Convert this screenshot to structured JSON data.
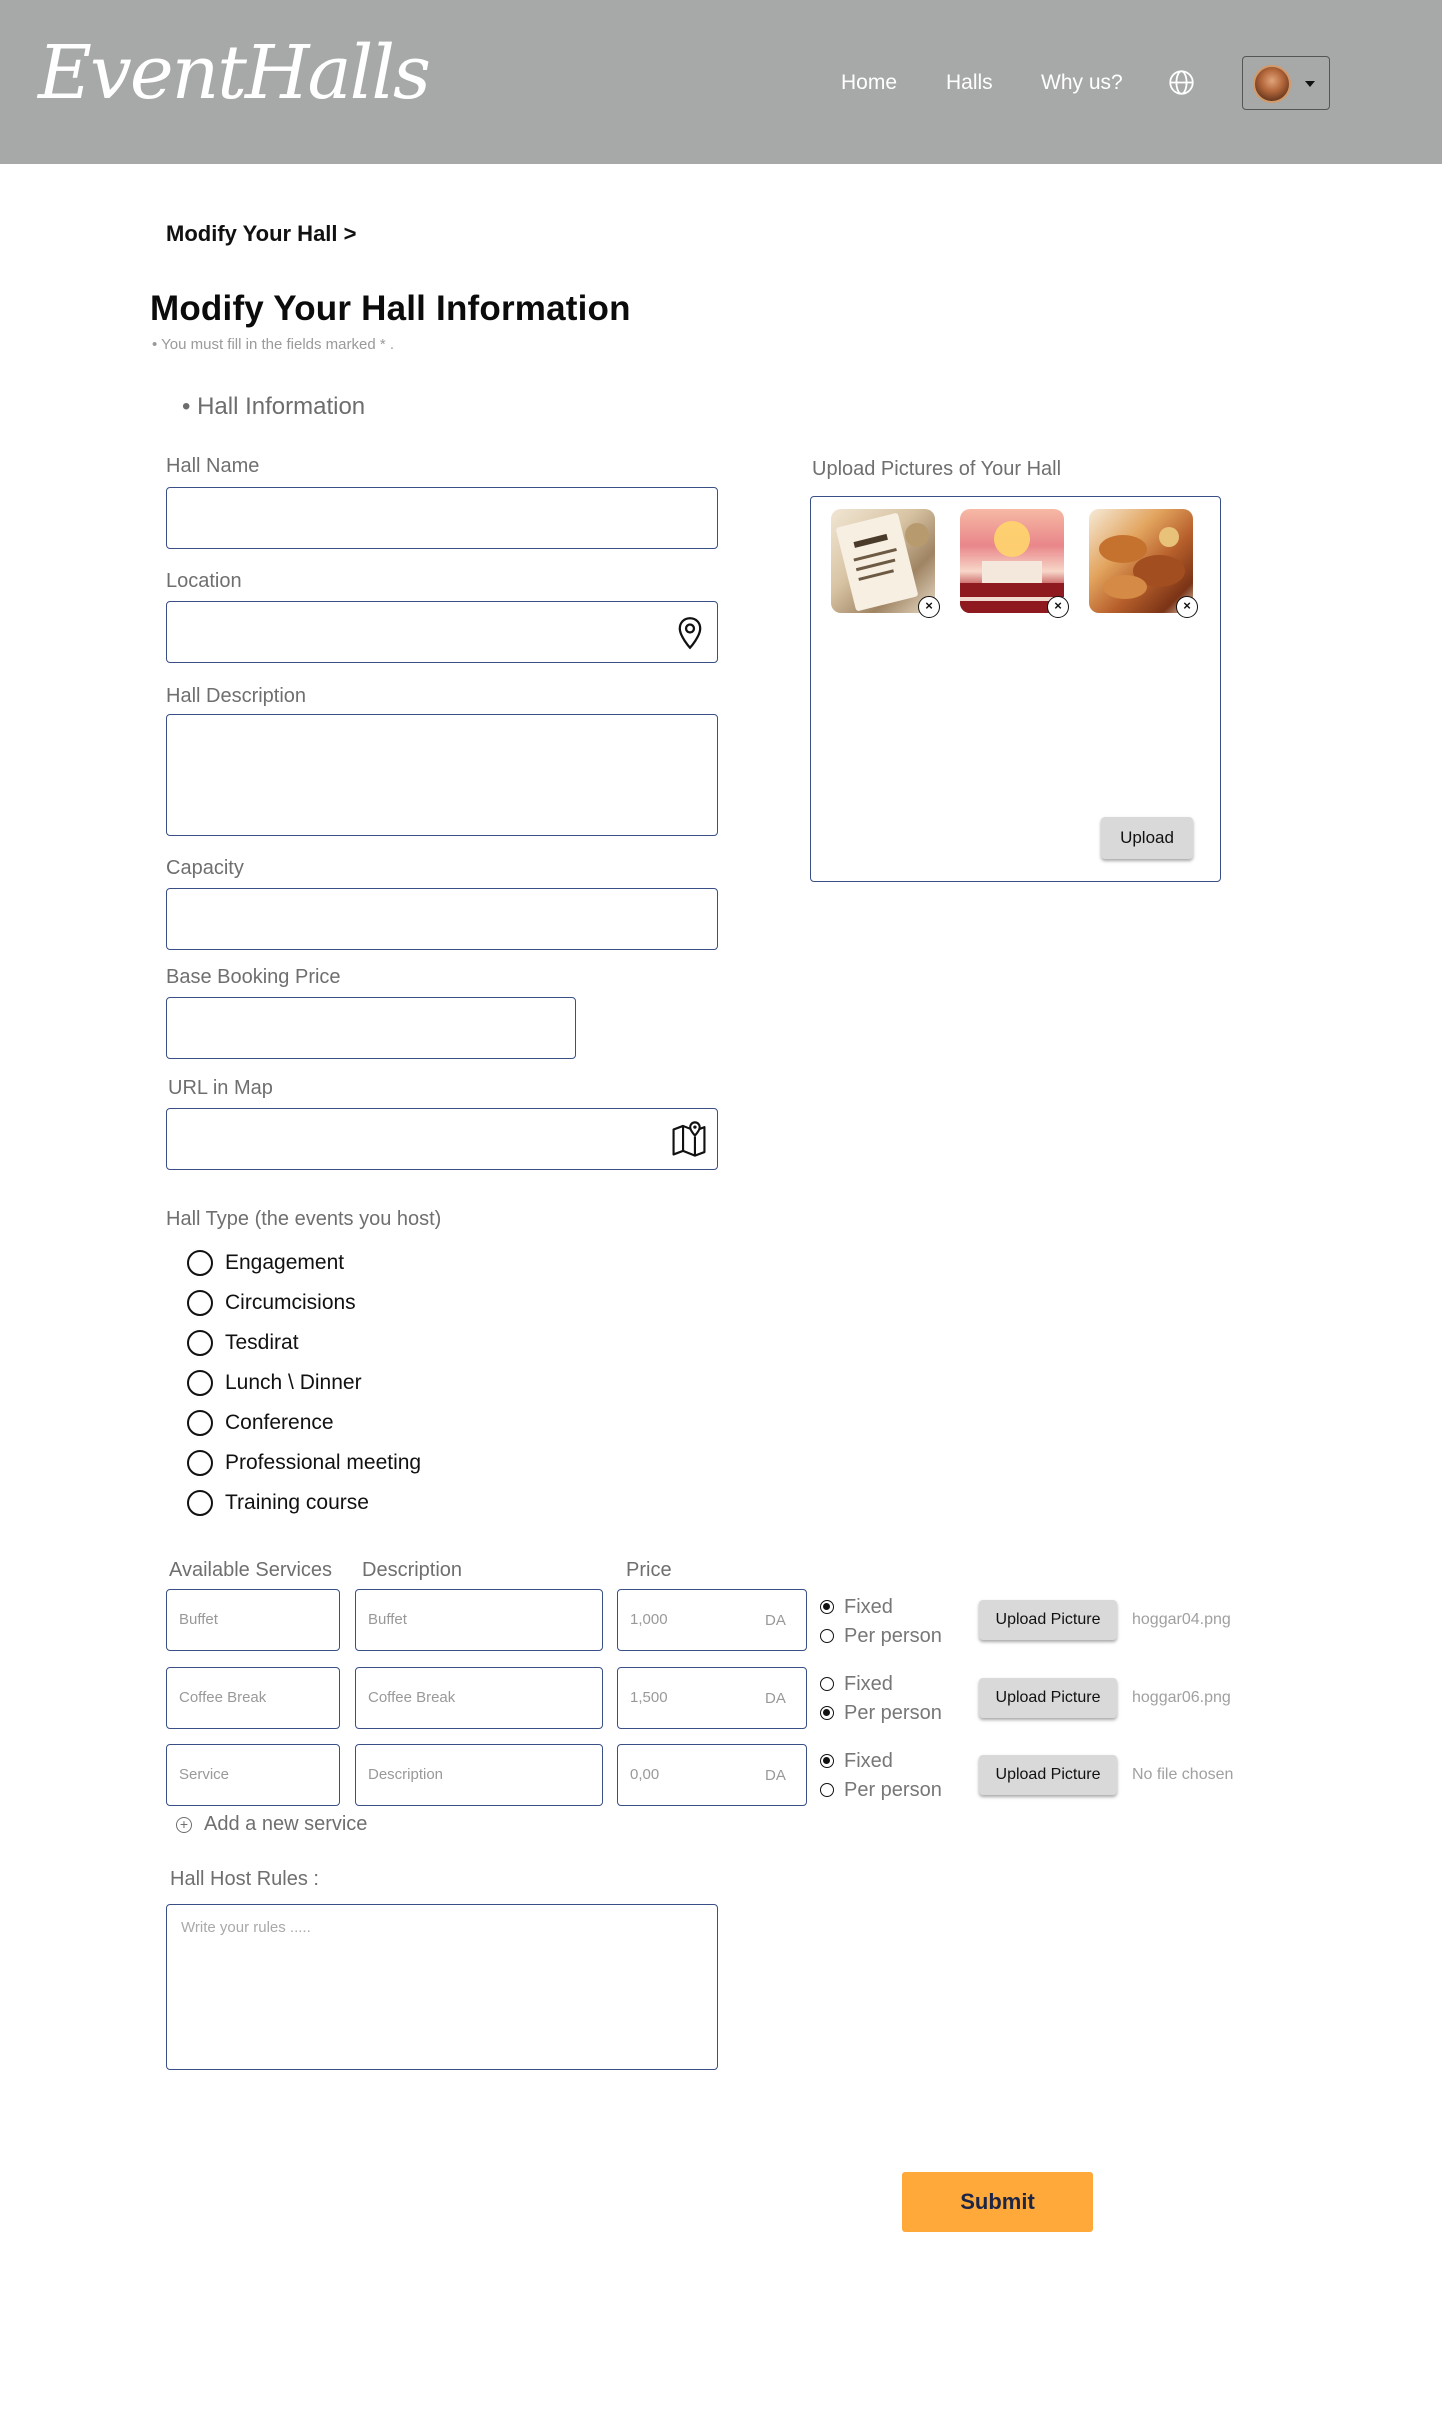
{
  "header": {
    "logo": "EventHalls",
    "nav": [
      "Home",
      "Halls",
      "Why us?"
    ]
  },
  "breadcrumb": "Modify Your Hall  >",
  "page_title": "Modify Your Hall Information",
  "hint": "•  You must fill in the fields marked * .",
  "section_title": "•  Hall Information",
  "fields": {
    "hall_name": "Hall Name",
    "location": "Location",
    "description": "Hall Description",
    "capacity": "Capacity",
    "base_price": "Base Booking Price",
    "url_map": "URL in Map"
  },
  "upload": {
    "label": "Upload Pictures of Your Hall",
    "button": "Upload"
  },
  "hall_type": {
    "label": "Hall Type (the events you host)",
    "options": [
      "Engagement",
      "Circumcisions",
      "Tesdirat",
      "Lunch \\ Dinner",
      "Conference",
      "Professional meeting",
      "Training course"
    ]
  },
  "services": {
    "headers": {
      "service": "Available Services",
      "description": "Description",
      "price": "Price"
    },
    "currency": "DA",
    "fixed_label": "Fixed",
    "per_person_label": "Per person",
    "upload_button": "Upload Picture",
    "rows": [
      {
        "service": "Buffet",
        "description": "Buffet",
        "price": "1,000",
        "selected": "fixed",
        "file": "hoggar04.png"
      },
      {
        "service": "Coffee Break",
        "description": "Coffee Break",
        "price": "1,500",
        "selected": "per_person",
        "file": "hoggar06.png"
      },
      {
        "service": "Service",
        "description": "Description",
        "price": "0,00",
        "selected": "fixed",
        "file": "No file chosen"
      }
    ],
    "add_label": "Add a new service"
  },
  "rules": {
    "label": "Hall Host Rules :",
    "placeholder": "Write your rules ....."
  },
  "submit": "Submit"
}
